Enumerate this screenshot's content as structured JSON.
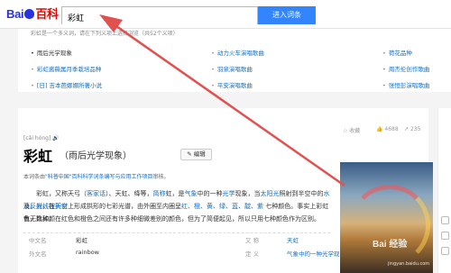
{
  "header": {
    "logo_left": "Bai",
    "logo_right": "百科",
    "search_value": "彩虹",
    "search_button": "进入词条"
  },
  "disambiguation": {
    "head": "彩虹是一个多义词，请在下列义项上选择浏览（共52个义项）",
    "items": [
      {
        "label": "雨后光学现象",
        "current": true
      },
      {
        "label": "动力火车演唱歌曲",
        "current": false
      },
      {
        "label": "荷花品种",
        "current": false
      },
      {
        "label": "彩虹酱薇属月季栽培品种",
        "current": false
      },
      {
        "label": "羽泉演唱歌曲",
        "current": false
      },
      {
        "label": "周杰伦创作歌曲",
        "current": false
      },
      {
        "label": "[日] 吉本芭娜娜所著小说",
        "current": false
      },
      {
        "label": "平安演唱歌曲",
        "current": false
      },
      {
        "label": "张恒彭演唱歌曲",
        "current": false
      }
    ],
    "more": "⌄"
  },
  "entry": {
    "pinyin": "[cǎi hóng]",
    "speaker": "🔊",
    "title": "彩虹",
    "subtitle": "（雨后光学现象）",
    "edit_label": "✎ 编辑",
    "stats": {
      "collect": "收藏",
      "likes": "4688",
      "shares": "235"
    },
    "note_prefix": "本词条由",
    "note_link": "\"科普中国\"百科科学词条编写与应用工作项目",
    "note_suffix": "审核。"
  },
  "paragraph": {
    "line1_a": "彩虹，又称天弓（",
    "line1_link1": "客家话",
    "line1_b": "）、天虹、绛等，",
    "line1_link2": "简称",
    "line1_c": "虹，是",
    "line1_link3": "气象",
    "line1_d": "中的一种",
    "line1_link4": "光学",
    "line1_e": "现象，当",
    "line1_link5": "太阳光",
    "line1_f": "照射到半空中的",
    "line1_link6": "水滴",
    "line1_g": "，",
    "line1_link7": "光线被折射",
    "line2_a": "及",
    "line2_link1": "反射",
    "line2_b": "，在",
    "line2_link2": "天空",
    "line2_c": "上形成拱形的七彩光谱，由外圈至内圈呈",
    "line2_colors": "红、橙、黄、绿、蓝、靛、紫",
    "line2_d": " 七种颜色。事实上彩虹有无数种颜",
    "line3": "色，比如，在红色和橙色之间还有许多种细微差别的颜色，但为了简便起见，所以只用七种颜色作为区别。"
  },
  "infobox": {
    "rows": [
      {
        "k1": "中文名",
        "v1": "彩虹",
        "k2": "又    称",
        "v2": "天虹",
        "v2_link": true
      },
      {
        "k1": "外文名",
        "v1": "rainbow",
        "k2": "定    义",
        "v2": "气象中的一种光学现象",
        "v2_link": true
      }
    ]
  },
  "watermark": {
    "text": "Bai 经验",
    "sub": "jingyan.baidu.com"
  },
  "colors": {
    "accent": "#3385ff",
    "link": "#136ec2",
    "arrow": "#e0514f"
  }
}
